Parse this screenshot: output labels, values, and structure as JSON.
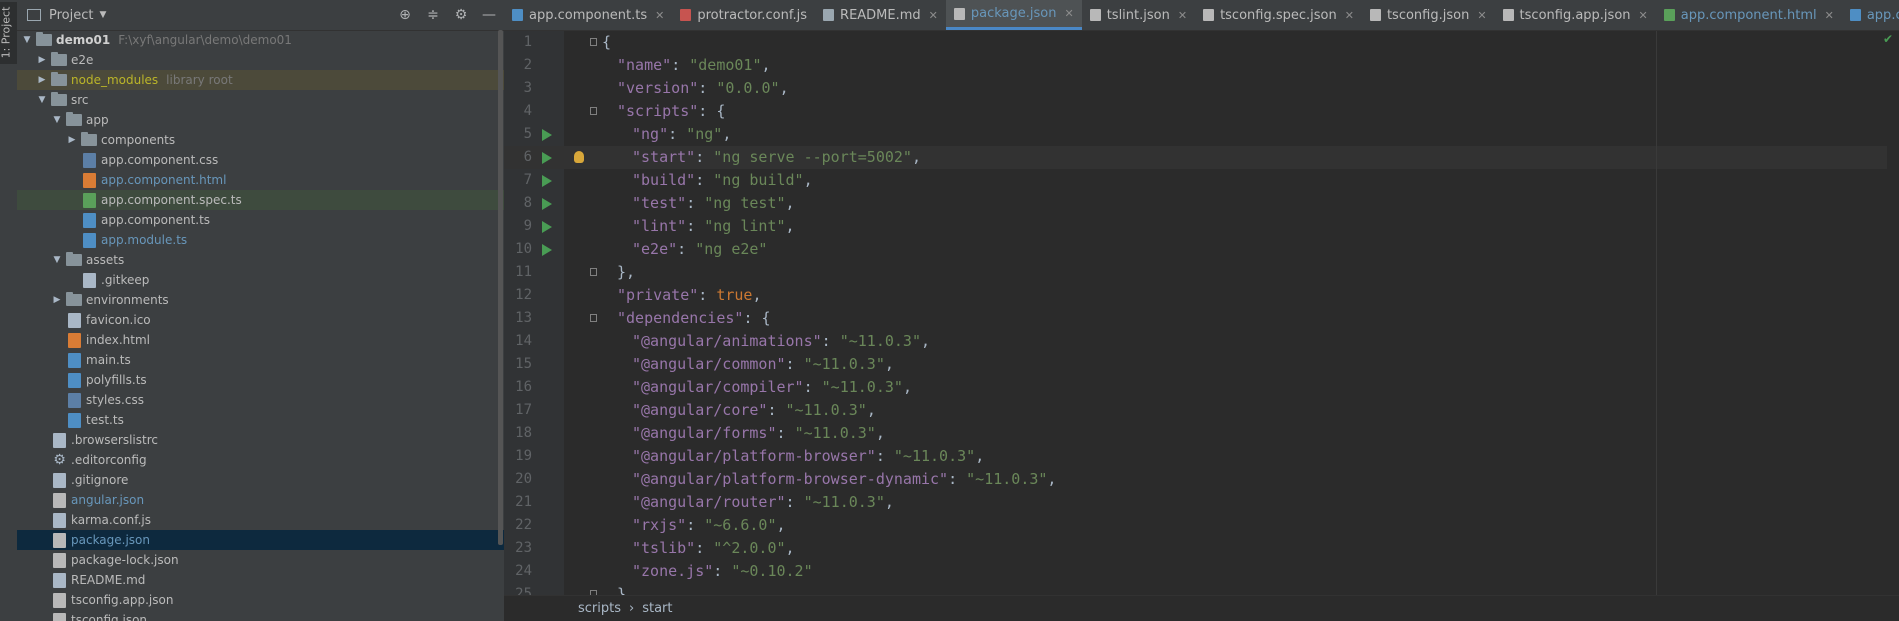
{
  "side_stripe": {
    "label": "1: Project"
  },
  "project_panel": {
    "title": "Project",
    "tree": [
      {
        "indent": 0,
        "arrow": "down",
        "type": "folder",
        "label": "demo01",
        "style": "bold",
        "hint": "F:\\xyf\\angular\\demo\\demo01"
      },
      {
        "indent": 1,
        "arrow": "right",
        "type": "folder",
        "label": "e2e",
        "style": ""
      },
      {
        "indent": 1,
        "arrow": "right",
        "type": "folder",
        "label": "node_modules",
        "style": "mod",
        "hint": "library root",
        "row": "hl-mod"
      },
      {
        "indent": 1,
        "arrow": "down",
        "type": "folder",
        "label": "src",
        "style": ""
      },
      {
        "indent": 2,
        "arrow": "down",
        "type": "folder",
        "label": "app",
        "style": ""
      },
      {
        "indent": 3,
        "arrow": "right",
        "type": "folder",
        "label": "components",
        "style": ""
      },
      {
        "indent": 3,
        "arrow": "",
        "type": "css",
        "label": "app.component.css",
        "style": ""
      },
      {
        "indent": 3,
        "arrow": "",
        "type": "html",
        "label": "app.component.html",
        "style": "blue"
      },
      {
        "indent": 3,
        "arrow": "",
        "type": "spec",
        "label": "app.component.spec.ts",
        "style": "",
        "row": "hl-spec"
      },
      {
        "indent": 3,
        "arrow": "",
        "type": "ts",
        "label": "app.component.ts",
        "style": ""
      },
      {
        "indent": 3,
        "arrow": "",
        "type": "ts",
        "label": "app.module.ts",
        "style": "blue"
      },
      {
        "indent": 2,
        "arrow": "down",
        "type": "folder",
        "label": "assets",
        "style": ""
      },
      {
        "indent": 3,
        "arrow": "",
        "type": "file",
        "label": ".gitkeep",
        "style": ""
      },
      {
        "indent": 2,
        "arrow": "right",
        "type": "folder",
        "label": "environments",
        "style": ""
      },
      {
        "indent": 2,
        "arrow": "",
        "type": "file",
        "label": "favicon.ico",
        "style": ""
      },
      {
        "indent": 2,
        "arrow": "",
        "type": "html",
        "label": "index.html",
        "style": ""
      },
      {
        "indent": 2,
        "arrow": "",
        "type": "ts",
        "label": "main.ts",
        "style": ""
      },
      {
        "indent": 2,
        "arrow": "",
        "type": "ts",
        "label": "polyfills.ts",
        "style": ""
      },
      {
        "indent": 2,
        "arrow": "",
        "type": "css",
        "label": "styles.css",
        "style": ""
      },
      {
        "indent": 2,
        "arrow": "",
        "type": "ts",
        "label": "test.ts",
        "style": ""
      },
      {
        "indent": 1,
        "arrow": "",
        "type": "file",
        "label": ".browserslistrc",
        "style": ""
      },
      {
        "indent": 1,
        "arrow": "",
        "type": "gear",
        "label": ".editorconfig",
        "style": ""
      },
      {
        "indent": 1,
        "arrow": "",
        "type": "file",
        "label": ".gitignore",
        "style": ""
      },
      {
        "indent": 1,
        "arrow": "",
        "type": "json",
        "label": "angular.json",
        "style": "blue"
      },
      {
        "indent": 1,
        "arrow": "",
        "type": "js",
        "label": "karma.conf.js",
        "style": ""
      },
      {
        "indent": 1,
        "arrow": "",
        "type": "json",
        "label": "package.json",
        "style": "blue",
        "row": "sel"
      },
      {
        "indent": 1,
        "arrow": "",
        "type": "json",
        "label": "package-lock.json",
        "style": ""
      },
      {
        "indent": 1,
        "arrow": "",
        "type": "file",
        "label": "README.md",
        "style": ""
      },
      {
        "indent": 1,
        "arrow": "",
        "type": "json",
        "label": "tsconfig.app.json",
        "style": ""
      },
      {
        "indent": 1,
        "arrow": "",
        "type": "json",
        "label": "tsconfig.json",
        "style": ""
      }
    ]
  },
  "tabs": [
    {
      "label": "app.component.ts",
      "icon": "#4e8ec4",
      "cls": "",
      "close": true
    },
    {
      "label": "protractor.conf.js",
      "icon": "#c75450",
      "cls": "",
      "close": false
    },
    {
      "label": "README.md",
      "icon": "#9aa7b0",
      "cls": "",
      "close": true
    },
    {
      "label": "package.json",
      "icon": "#b8b8b8",
      "cls": "active",
      "close": true
    },
    {
      "label": "tslint.json",
      "icon": "#b8b8b8",
      "cls": "",
      "close": true
    },
    {
      "label": "tsconfig.spec.json",
      "icon": "#b8b8b8",
      "cls": "",
      "close": true
    },
    {
      "label": "tsconfig.json",
      "icon": "#b8b8b8",
      "cls": "",
      "close": true
    },
    {
      "label": "tsconfig.app.json",
      "icon": "#b8b8b8",
      "cls": "",
      "close": true
    },
    {
      "label": "app.component.html",
      "icon": "#5aa05a",
      "cls": "blue",
      "close": true
    },
    {
      "label": "app.com",
      "icon": "#4e8ec4",
      "cls": "blue",
      "close": false
    }
  ],
  "code_lines": [
    {
      "n": "1",
      "indent": 0,
      "tokens": [
        [
          "ct",
          "{"
        ]
      ],
      "fold": true
    },
    {
      "n": "2",
      "indent": 1,
      "tokens": [
        [
          "k",
          "\"name\""
        ],
        [
          "ct",
          ": "
        ],
        [
          "s",
          "\"demo01\""
        ],
        [
          "ct",
          ","
        ]
      ]
    },
    {
      "n": "3",
      "indent": 1,
      "tokens": [
        [
          "k",
          "\"version\""
        ],
        [
          "ct",
          ": "
        ],
        [
          "s",
          "\"0.0.0\""
        ],
        [
          "ct",
          ","
        ]
      ]
    },
    {
      "n": "4",
      "indent": 1,
      "tokens": [
        [
          "k",
          "\"scripts\""
        ],
        [
          "ct",
          ": {"
        ]
      ],
      "fold": true
    },
    {
      "n": "5",
      "indent": 2,
      "tokens": [
        [
          "k",
          "\"ng\""
        ],
        [
          "ct",
          ": "
        ],
        [
          "s",
          "\"ng\""
        ],
        [
          "ct",
          ","
        ]
      ],
      "run": true
    },
    {
      "n": "6",
      "indent": 2,
      "tokens": [
        [
          "k",
          "\"start\""
        ],
        [
          "ct",
          ": "
        ],
        [
          "s",
          "\"ng serve --port=5002\""
        ],
        [
          "ct",
          ","
        ]
      ],
      "run": true,
      "bulb": true,
      "cur": true
    },
    {
      "n": "7",
      "indent": 2,
      "tokens": [
        [
          "k",
          "\"build\""
        ],
        [
          "ct",
          ": "
        ],
        [
          "s",
          "\"ng build\""
        ],
        [
          "ct",
          ","
        ]
      ],
      "run": true
    },
    {
      "n": "8",
      "indent": 2,
      "tokens": [
        [
          "k",
          "\"test\""
        ],
        [
          "ct",
          ": "
        ],
        [
          "s",
          "\"ng test\""
        ],
        [
          "ct",
          ","
        ]
      ],
      "run": true
    },
    {
      "n": "9",
      "indent": 2,
      "tokens": [
        [
          "k",
          "\"lint\""
        ],
        [
          "ct",
          ": "
        ],
        [
          "s",
          "\"ng lint\""
        ],
        [
          "ct",
          ","
        ]
      ],
      "run": true
    },
    {
      "n": "10",
      "indent": 2,
      "tokens": [
        [
          "k",
          "\"e2e\""
        ],
        [
          "ct",
          ": "
        ],
        [
          "s",
          "\"ng e2e\""
        ]
      ],
      "run": true
    },
    {
      "n": "11",
      "indent": 1,
      "tokens": [
        [
          "ct",
          "},"
        ]
      ],
      "fold": true
    },
    {
      "n": "12",
      "indent": 1,
      "tokens": [
        [
          "k",
          "\"private\""
        ],
        [
          "ct",
          ": "
        ],
        [
          "o",
          "true"
        ],
        [
          "ct",
          ","
        ]
      ]
    },
    {
      "n": "13",
      "indent": 1,
      "tokens": [
        [
          "k",
          "\"dependencies\""
        ],
        [
          "ct",
          ": {"
        ]
      ],
      "fold": true
    },
    {
      "n": "14",
      "indent": 2,
      "tokens": [
        [
          "k",
          "\"@angular/animations\""
        ],
        [
          "ct",
          ": "
        ],
        [
          "s",
          "\"~11.0.3\""
        ],
        [
          "ct",
          ","
        ]
      ]
    },
    {
      "n": "15",
      "indent": 2,
      "tokens": [
        [
          "k",
          "\"@angular/common\""
        ],
        [
          "ct",
          ": "
        ],
        [
          "s",
          "\"~11.0.3\""
        ],
        [
          "ct",
          ","
        ]
      ]
    },
    {
      "n": "16",
      "indent": 2,
      "tokens": [
        [
          "k",
          "\"@angular/compiler\""
        ],
        [
          "ct",
          ": "
        ],
        [
          "s",
          "\"~11.0.3\""
        ],
        [
          "ct",
          ","
        ]
      ]
    },
    {
      "n": "17",
      "indent": 2,
      "tokens": [
        [
          "k",
          "\"@angular/core\""
        ],
        [
          "ct",
          ": "
        ],
        [
          "s",
          "\"~11.0.3\""
        ],
        [
          "ct",
          ","
        ]
      ]
    },
    {
      "n": "18",
      "indent": 2,
      "tokens": [
        [
          "k",
          "\"@angular/forms\""
        ],
        [
          "ct",
          ": "
        ],
        [
          "s",
          "\"~11.0.3\""
        ],
        [
          "ct",
          ","
        ]
      ]
    },
    {
      "n": "19",
      "indent": 2,
      "tokens": [
        [
          "k",
          "\"@angular/platform-browser\""
        ],
        [
          "ct",
          ": "
        ],
        [
          "s",
          "\"~11.0.3\""
        ],
        [
          "ct",
          ","
        ]
      ]
    },
    {
      "n": "20",
      "indent": 2,
      "tokens": [
        [
          "k",
          "\"@angular/platform-browser-dynamic\""
        ],
        [
          "ct",
          ": "
        ],
        [
          "s",
          "\"~11.0.3\""
        ],
        [
          "ct",
          ","
        ]
      ]
    },
    {
      "n": "21",
      "indent": 2,
      "tokens": [
        [
          "k",
          "\"@angular/router\""
        ],
        [
          "ct",
          ": "
        ],
        [
          "s",
          "\"~11.0.3\""
        ],
        [
          "ct",
          ","
        ]
      ]
    },
    {
      "n": "22",
      "indent": 2,
      "tokens": [
        [
          "k",
          "\"rxjs\""
        ],
        [
          "ct",
          ": "
        ],
        [
          "s",
          "\"~6.6.0\""
        ],
        [
          "ct",
          ","
        ]
      ]
    },
    {
      "n": "23",
      "indent": 2,
      "tokens": [
        [
          "k",
          "\"tslib\""
        ],
        [
          "ct",
          ": "
        ],
        [
          "s",
          "\"^2.0.0\""
        ],
        [
          "ct",
          ","
        ]
      ]
    },
    {
      "n": "24",
      "indent": 2,
      "tokens": [
        [
          "k",
          "\"zone.js\""
        ],
        [
          "ct",
          ": "
        ],
        [
          "s",
          "\"~0.10.2\""
        ]
      ]
    },
    {
      "n": "25",
      "indent": 1,
      "tokens": [
        [
          "ct",
          "},"
        ]
      ],
      "fold": true
    }
  ],
  "breadcrumb": {
    "first": "scripts",
    "sep": "›",
    "second": "start"
  }
}
